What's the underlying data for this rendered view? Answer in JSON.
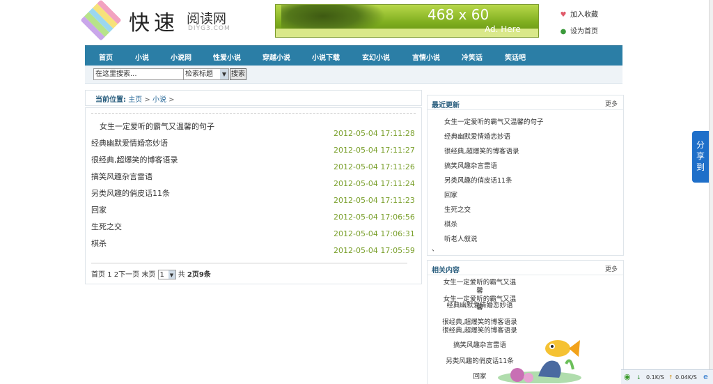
{
  "header": {
    "logo_main": "快速",
    "logo_sub": "阅读网",
    "logo_domain": "DIYG3.COM",
    "logo_colors": [
      "#f2a2c0",
      "#f7e27a",
      "#9ad7f0",
      "#b7e38a",
      "#c9a6ea"
    ],
    "banner_size": "468 x 60",
    "banner_text": "Ad. Here",
    "links": [
      {
        "label": "加入收藏",
        "icon": "heart-icon"
      },
      {
        "label": "设为首页",
        "icon": "green-dot-icon"
      }
    ]
  },
  "nav": {
    "items": [
      "首页",
      "小说",
      "小说网",
      "性爱小说",
      "穿越小说",
      "小说下载",
      "玄幻小说",
      "言情小说",
      "冷笑话",
      "笑话吧"
    ]
  },
  "search": {
    "input_value": "在这里搜索...",
    "select_value": "检索标题",
    "button": "搜索"
  },
  "breadcrumb": {
    "label": "当前位置:",
    "home": "主页",
    "section": "小说",
    "sep": ">"
  },
  "articles": [
    {
      "title": "女生一定爱听的霸气又温馨的句子",
      "date": "2012-05-04 17:11:28"
    },
    {
      "title": "经典幽默爱情婚恋妙语",
      "date": "2012-05-04 17:11:27"
    },
    {
      "title": "很经典,超爆笑的博客语录",
      "date": "2012-05-04 17:11:26"
    },
    {
      "title": "搞笑风趣杂言雷语",
      "date": "2012-05-04 17:11:24"
    },
    {
      "title": "另类风趣的俏皮话11条",
      "date": "2012-05-04 17:11:23"
    },
    {
      "title": "回家",
      "date": "2012-05-04 17:06:56"
    },
    {
      "title": "生死之交",
      "date": "2012-05-04 17:06:31"
    },
    {
      "title": "棋杀",
      "date": "2012-05-04 17:05:59"
    }
  ],
  "pager": {
    "first": "首页",
    "p1": "1",
    "p2": "2",
    "next": "下一页",
    "last": "末页",
    "select_value": "1",
    "total_prefix": "共",
    "total_pages": "2页",
    "total_items": "9条"
  },
  "recent": {
    "title": "最近更新",
    "more": "更多",
    "items": [
      "女生一定爱听的霸气又温馨的句子",
      "经典幽默爱情婚恋妙语",
      "很经典,超爆笑的博客语录",
      "搞笑风趣杂言雷语",
      "另类风趣的俏皮话11条",
      "回家",
      "生死之交",
      "棋杀",
      "听老人叙说"
    ],
    "trailing_mark": "、"
  },
  "related": {
    "title": "相关内容",
    "more": "更多",
    "items": [
      "女生一定爱听的霸气又温馨",
      "经典幽默爱情婚恋妙语",
      "很经典,超爆笑的博客语录",
      "搞笑风趣杂言雷语",
      "另类风趣的俏皮话11条",
      "回家"
    ],
    "item_wrap": [
      "女生一定爱听的霸气又温馨",
      "",
      "很经典,超爆笑的博客语录",
      "",
      "",
      ""
    ]
  },
  "share": {
    "label": "分享到"
  },
  "status": {
    "down": "0.1K/S",
    "up": "0.04K/S"
  },
  "colors": {
    "nav": "#2b7ea6",
    "date": "#7aa02c",
    "share": "#1f6fc9"
  }
}
